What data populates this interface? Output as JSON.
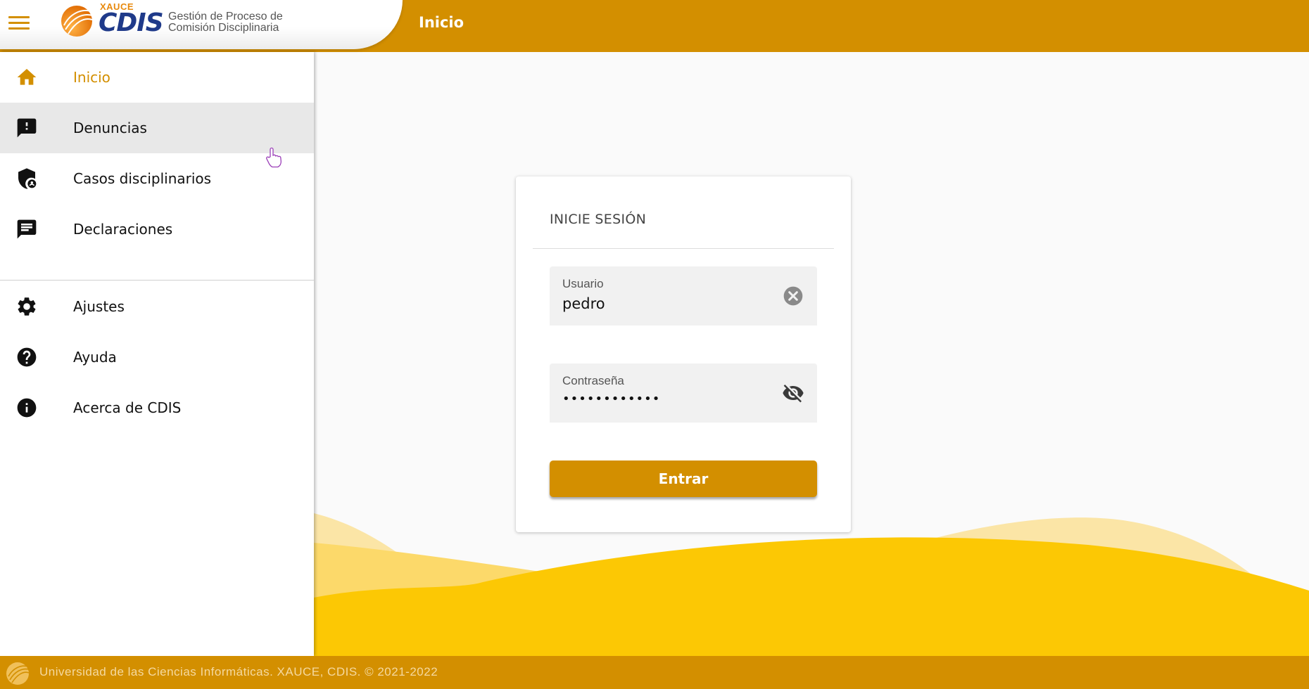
{
  "header": {
    "title": "Inicio",
    "brand_sup": "XAUCE",
    "brand_main": "CDIS",
    "brand_sub": "Gestión de Proceso de Comisión Disciplinaria"
  },
  "sidebar": {
    "items": [
      {
        "label": "Inicio",
        "icon": "home-icon",
        "state": "active"
      },
      {
        "label": "Denuncias",
        "icon": "report-icon",
        "state": "hover"
      },
      {
        "label": "Casos disciplinarios",
        "icon": "shield-user-icon"
      },
      {
        "label": "Declaraciones",
        "icon": "message-icon"
      },
      {
        "label": "Ajustes",
        "icon": "gear-icon"
      },
      {
        "label": "Ayuda",
        "icon": "help-icon"
      },
      {
        "label": "Acerca de CDIS",
        "icon": "info-icon"
      }
    ]
  },
  "login": {
    "title": "INICIE SESIÓN",
    "user_label": "Usuario",
    "user_value": "pedro",
    "password_label": "Contraseña",
    "password_value": "••••••••••••",
    "submit_label": "Entrar"
  },
  "footer": {
    "text": "Universidad de las Ciencias Informáticas. XAUCE, CDIS. © 2021-2022"
  },
  "colors": {
    "accent": "#d38f00",
    "brand_blue": "#1f3a8a",
    "wave_light": "#fbe5a6",
    "wave_mid": "#fcd96a",
    "wave_dark": "#fcc804"
  }
}
